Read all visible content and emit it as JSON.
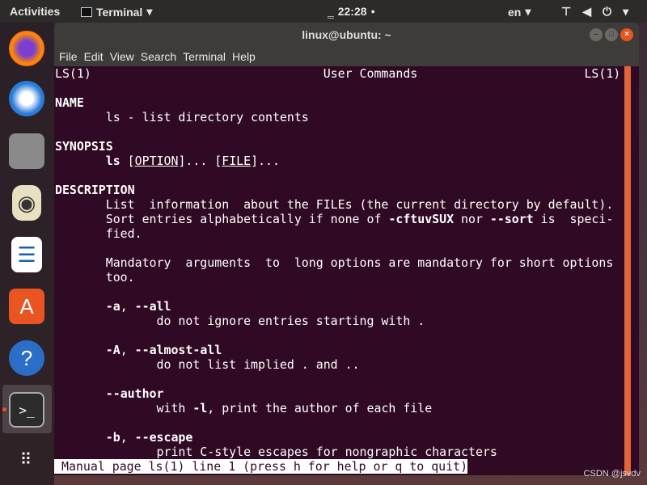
{
  "topbar": {
    "activities": "Activities",
    "app": "Terminal",
    "clock": "22:28",
    "lang": "en"
  },
  "dock": {
    "items": [
      "firefox",
      "thunderbird",
      "files",
      "rhythmbox",
      "libreoffice-writer",
      "software-center",
      "help",
      "terminal",
      "show-apps"
    ]
  },
  "window": {
    "title": "linux@ubuntu: ~",
    "menu": [
      "File",
      "Edit",
      "View",
      "Search",
      "Terminal",
      "Help"
    ]
  },
  "man": {
    "lines": [
      [
        [
          "LS(1)                                User Commands                       LS(1)",
          ""
        ]
      ],
      [],
      [
        [
          "NAME",
          "b"
        ]
      ],
      [
        [
          "       ls - list directory contents",
          ""
        ]
      ],
      [],
      [
        [
          "SYNOPSIS",
          "b"
        ]
      ],
      [
        [
          "       ",
          ""
        ],
        [
          "ls",
          "b"
        ],
        [
          " [",
          ""
        ],
        [
          "OPTION",
          "u"
        ],
        [
          "]... [",
          ""
        ],
        [
          "FILE",
          "u"
        ],
        [
          "]...",
          ""
        ]
      ],
      [],
      [
        [
          "DESCRIPTION",
          "b"
        ]
      ],
      [
        [
          "       List  information  about the FILEs (the current directory by default).",
          ""
        ]
      ],
      [
        [
          "       Sort entries alphabetically if none of ",
          ""
        ],
        [
          "-cftuvSUX",
          "b"
        ],
        [
          " nor ",
          ""
        ],
        [
          "--sort",
          "b"
        ],
        [
          " is  speci-",
          ""
        ]
      ],
      [
        [
          "       fied.",
          ""
        ]
      ],
      [],
      [
        [
          "       Mandatory  arguments  to  long options are mandatory for short options",
          ""
        ]
      ],
      [
        [
          "       too.",
          ""
        ]
      ],
      [],
      [
        [
          "       ",
          ""
        ],
        [
          "-a",
          "b"
        ],
        [
          ", ",
          ""
        ],
        [
          "--all",
          "b"
        ]
      ],
      [
        [
          "              do not ignore entries starting with .",
          ""
        ]
      ],
      [],
      [
        [
          "       ",
          ""
        ],
        [
          "-A",
          "b"
        ],
        [
          ", ",
          ""
        ],
        [
          "--almost-all",
          "b"
        ]
      ],
      [
        [
          "              do not list implied . and ..",
          ""
        ]
      ],
      [],
      [
        [
          "       ",
          ""
        ],
        [
          "--author",
          "b"
        ]
      ],
      [
        [
          "              with ",
          ""
        ],
        [
          "-l",
          "b"
        ],
        [
          ", print the author of each file",
          ""
        ]
      ],
      [],
      [
        [
          "       ",
          ""
        ],
        [
          "-b",
          "b"
        ],
        [
          ", ",
          ""
        ],
        [
          "--escape",
          "b"
        ]
      ],
      [
        [
          "              print C-style escapes for nongraphic characters",
          ""
        ]
      ]
    ],
    "status": "Manual page ls(1) line 1 (press h for help or q to quit)"
  },
  "watermark": "CSDN @jsvdv",
  "colors": {
    "terminal_bg": "#300a24",
    "scrollbar": "#e0663a",
    "close": "#e95420"
  }
}
